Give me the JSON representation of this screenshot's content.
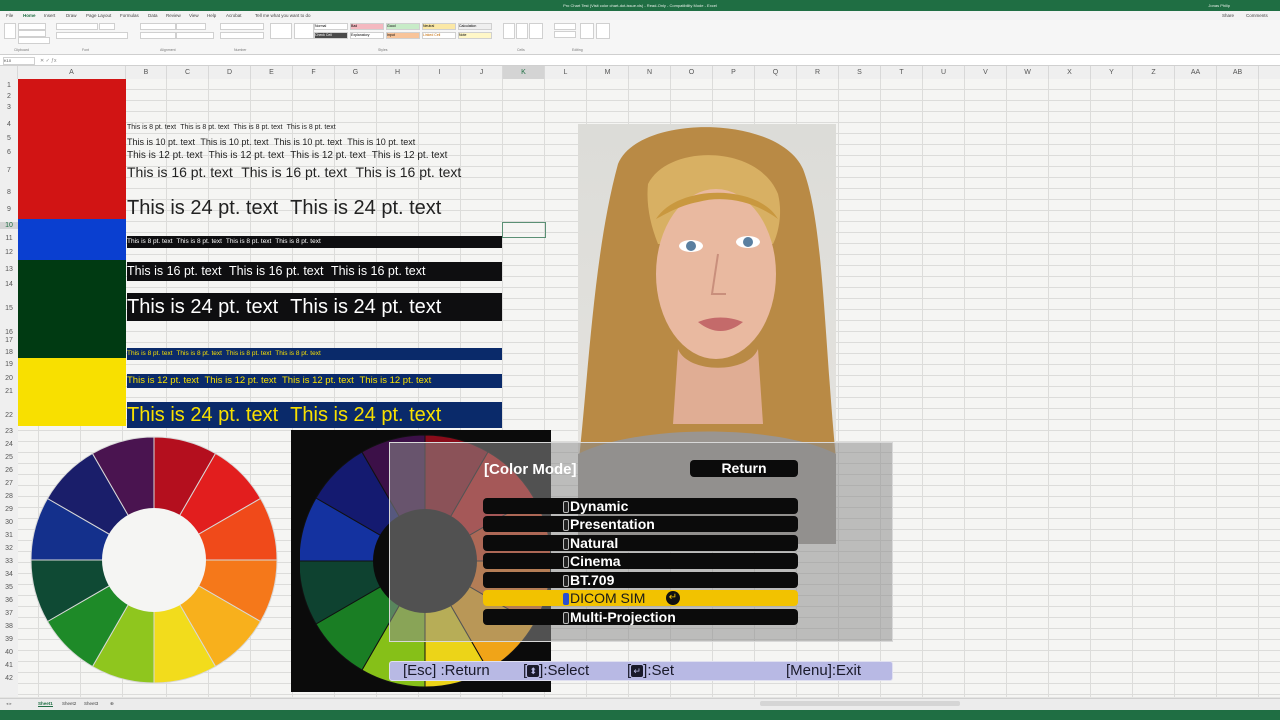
{
  "excel": {
    "title": "Pro Chart Test (Visit color chart-dot-issue.xls) - Read-Only - Compatibility Mode - Excel",
    "user": "Jonas Philip",
    "menu": [
      "File",
      "Home",
      "Insert",
      "Draw",
      "Page Layout",
      "Formulas",
      "Data",
      "Review",
      "View",
      "Help",
      "Acrobat",
      "Tell me what you want to do"
    ],
    "share_label": "Share",
    "comments_label": "Comments",
    "ribbon_groups": [
      "Clipboard",
      "Font",
      "Alignment",
      "Number",
      "Styles",
      "Cells",
      "Editing"
    ],
    "style_labels": [
      "Normal",
      "Bad",
      "Good",
      "Neutral",
      "Calculation",
      "Check Cell",
      "Explanatory",
      "Input",
      "Linked Cell",
      "Note"
    ],
    "name_box": "K10",
    "columns": [
      "A",
      "B",
      "C",
      "D",
      "E",
      "F",
      "G",
      "H",
      "I",
      "J",
      "K",
      "L",
      "M",
      "N",
      "O",
      "P",
      "Q",
      "R",
      "S",
      "T",
      "U",
      "V",
      "W",
      "X",
      "Y",
      "Z",
      "AA",
      "AB"
    ],
    "rows": [
      "1",
      "2",
      "3",
      "4",
      "5",
      "6",
      "7",
      "8",
      "9",
      "10",
      "11",
      "12",
      "13",
      "14",
      "15",
      "16",
      "17",
      "18",
      "19",
      "20",
      "21",
      "22",
      "23",
      "24",
      "25",
      "26",
      "27",
      "28",
      "29",
      "30",
      "31",
      "32",
      "33",
      "34",
      "35",
      "36",
      "37",
      "38",
      "39",
      "40",
      "41",
      "42"
    ],
    "sheet_tabs": [
      "Sheet1",
      "Sheet2",
      "Sheet3"
    ],
    "colors": {
      "green": "#1f6e43",
      "red": "#d11414",
      "blue": "#0a3fd0",
      "darkgreen": "#003a12",
      "yellow": "#f8e000"
    }
  },
  "text_samples": {
    "t8": "This is 8 pt. text",
    "t10": "This is 10 pt. text",
    "t12": "This is 12 pt. text",
    "t16": "This is 16 pt. text",
    "t24": "This is 24 pt. text"
  },
  "osd": {
    "title": "[Color Mode]",
    "return_label": "Return",
    "options": [
      "Dynamic",
      "Presentation",
      "Natural",
      "Cinema",
      "BT.709",
      "DICOM SIM",
      "Multi-Projection"
    ],
    "selected": "DICOM SIM",
    "help": {
      "esc": "[Esc] :Return",
      "select_pre": "[",
      "select_post": "]:Select",
      "set_pre": "[",
      "set_post": "]:Set",
      "menu": "[Menu]:Exit"
    },
    "colors": {
      "selected_bg": "#f2c200",
      "help_bg": "#b8b9e4"
    }
  }
}
